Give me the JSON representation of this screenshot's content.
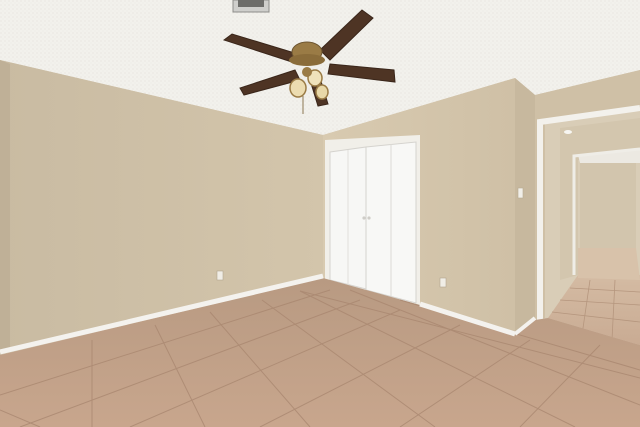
{
  "scene": {
    "room": "empty-bedroom",
    "fixtures": [
      "ceiling-fan",
      "bifold-closet",
      "open-doorway",
      "light-switch",
      "outlet",
      "air-vent"
    ],
    "colors": {
      "ceiling": "#f2f1ec",
      "left_wall": "#cdbfa6",
      "back_wall": "#d6c8ae",
      "right_wall": "#cbbca3",
      "floor": "#c19f86",
      "grout": "#a8866f",
      "baseboard": "#f4f2ee",
      "closet_door": "#f7f7f5",
      "fan_blade": "#4e3424",
      "fan_brass": "#9a7b45"
    }
  }
}
